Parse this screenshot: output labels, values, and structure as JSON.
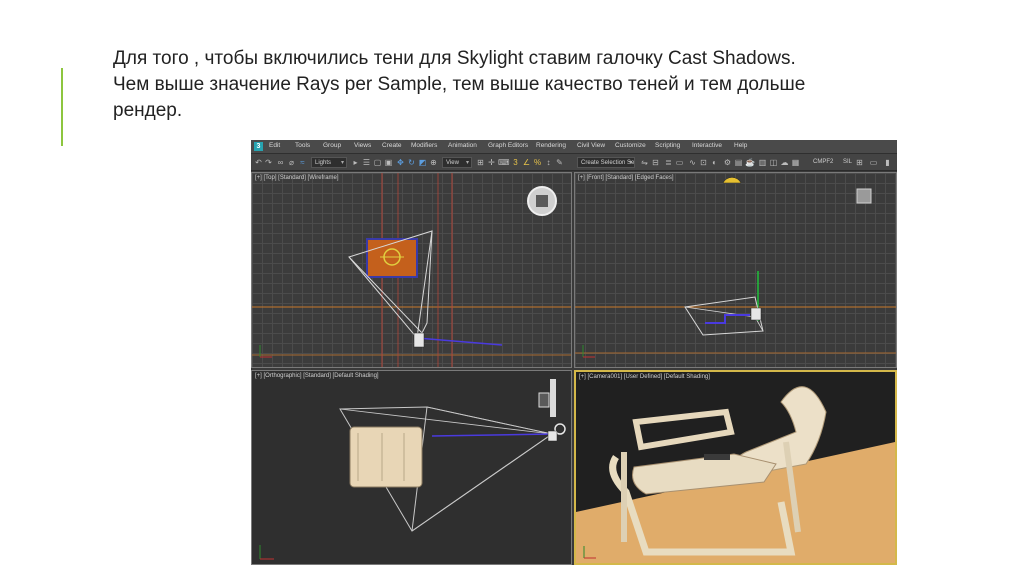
{
  "slide": {
    "lines": [
      "Для того , чтобы включились тени для Skylight ставим галочку Cast Shadows.",
      "Чем выше значение Rays per Sample, тем выше качество теней и тем дольше",
      "рендер."
    ],
    "accent_color": "#8dc63f"
  },
  "app": {
    "menu": [
      "Edit",
      "Tools",
      "Group",
      "Views",
      "Create",
      "Modifiers",
      "Animation",
      "Graph Editors",
      "Rendering",
      "Civil View",
      "Customize",
      "Scripting",
      "Interactive",
      "Help"
    ],
    "toolbar": {
      "filter_value": "Lights",
      "view_value": "View",
      "selection_set_placeholder": "Create Selection Se",
      "right_text_1": "CMPF2",
      "right_text_2": "SIL"
    },
    "viewports": {
      "top_label": "[+] [Top] [Standard] [Wireframe]",
      "front_label": "[+] [Front] [Standard] [Edged Faces]",
      "ortho_label": "[+] [Orthographic] [Standard] [Default Shading]",
      "camera_label": "[+] [Camera001] [User Defined] [Default Shading]"
    },
    "colors": {
      "grid_major": "#c8782a",
      "floor": "#e0ac6a",
      "chair_wood": "#e6d6b8",
      "gizmo_blue": "#5a4adf",
      "camera_border": "#d4b84a"
    }
  }
}
